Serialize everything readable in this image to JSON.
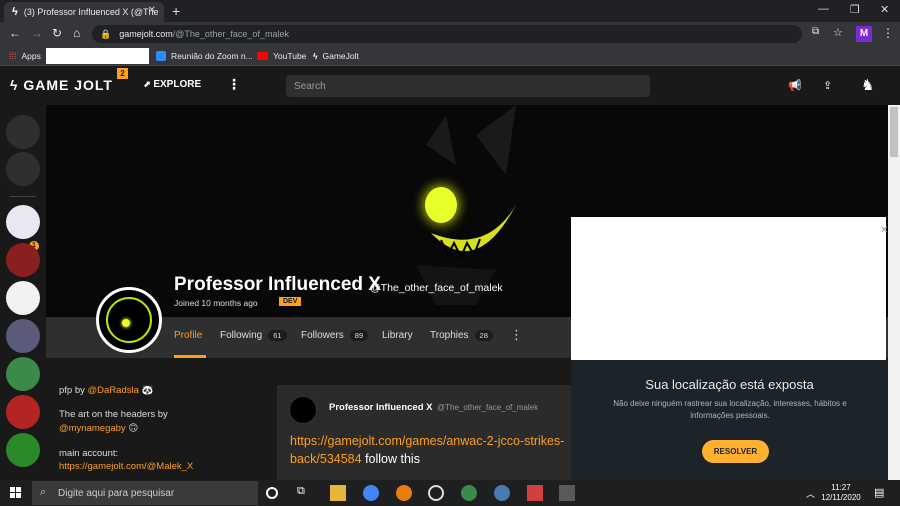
{
  "browser": {
    "tab_title": "(3) Professor Influenced X (@The",
    "new_tab": "+",
    "tab_close": "✕",
    "url_host": "gamejolt.com",
    "url_path": "/@The_other_face_of_malek",
    "profile_initial": "M",
    "bookmarks": [
      {
        "label": "Apps"
      },
      {
        "label": "Reunião do Zoom n..."
      },
      {
        "label": "YouTube"
      },
      {
        "label": "GameJolt"
      }
    ]
  },
  "site": {
    "logo": "GAME JOLT",
    "logo_badge": "2",
    "explore": "EXPLORE",
    "search_placeholder": "Search",
    "sidebar_badge": "1"
  },
  "profile": {
    "name": "Professor Influenced X",
    "handle": "@The_other_face_of_malek",
    "joined": "Joined 10 months ago",
    "badge": "DEV",
    "tabs": {
      "profile": "Profile",
      "following": "Following",
      "following_count": "61",
      "followers": "Followers",
      "followers_count": "89",
      "library": "Library",
      "trophies": "Trophies",
      "trophies_count": "28"
    }
  },
  "bio": {
    "line1_prefix": "pfp by ",
    "line1_link": "@DaRadsla",
    "line2": "The art on the headers by",
    "line3_link": "@mynamegaby",
    "line4": "main account:",
    "line5_link": "https://gamejolt.com/@Malek_X"
  },
  "post": {
    "author": "Professor Influenced X",
    "handle": "@The_other_face_of_malek",
    "link_text": "https://gamejolt.com/games/anwac-2-jcco-strikes-back/534584",
    "follow_text": " follow this"
  },
  "popup": {
    "title": "Sua localização está exposta",
    "description": "Não deixe ninguém rastrear sua localização, interesses, hábitos e informações pessoais.",
    "button": "RESOLVER"
  },
  "taskbar": {
    "search_placeholder": "Digite aqui para pesquisar",
    "time": "11:27",
    "date": "12/11/2020"
  }
}
